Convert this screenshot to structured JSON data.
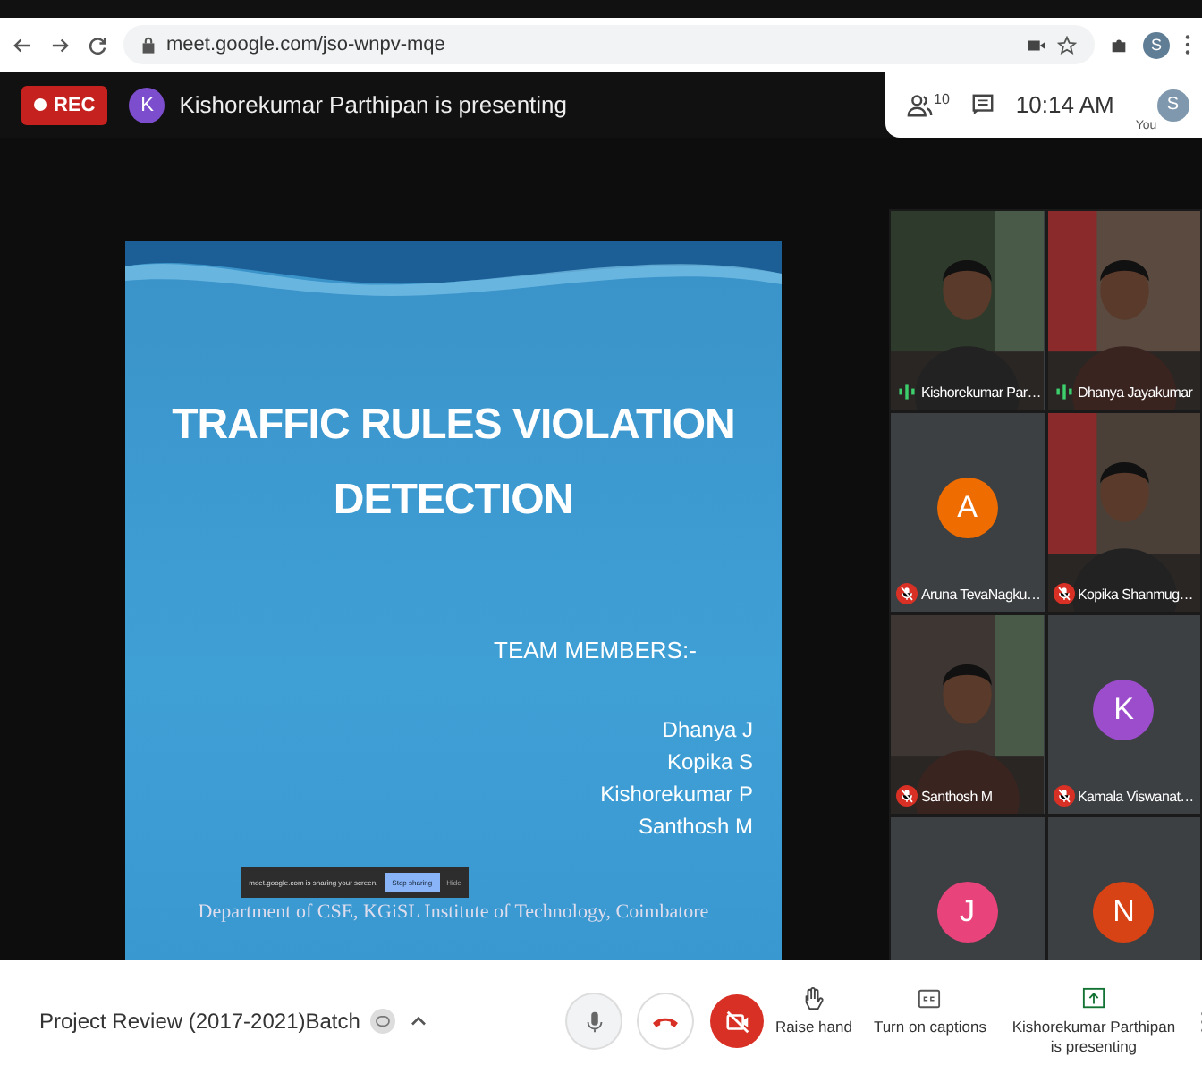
{
  "browser": {
    "url": "meet.google.com/jso-wnpv-mqe",
    "profile_initial": "S"
  },
  "header": {
    "rec_label": "REC",
    "presenter_initial": "K",
    "presenter_text": "Kishorekumar Parthipan is presenting",
    "participant_count": "10",
    "time": "10:14 AM",
    "you_label": "You",
    "you_initial": "S"
  },
  "slide": {
    "title_lines": [
      "TRAFFIC RULES VIOLATION",
      "DETECTION"
    ],
    "team_heading": "TEAM MEMBERS:-",
    "members": [
      "Dhanya J",
      "Kopika S",
      "Kishorekumar P",
      "Santhosh M"
    ],
    "share_bar": {
      "message": "meet.google.com is sharing your screen.",
      "stop": "Stop sharing",
      "hide": "Hide"
    },
    "footer": "Department of CSE, KGiSL Institute of Technology, Coimbatore"
  },
  "tiles": [
    {
      "kind": "picture",
      "name": "Kishorekumar Par…",
      "muted": false
    },
    {
      "kind": "picture",
      "name": "Dhanya Jayakumar",
      "muted": false
    },
    {
      "kind": "avatar",
      "initial": "A",
      "color": "#ef6c00",
      "name": "Aruna TevaNagku…",
      "muted": true
    },
    {
      "kind": "picture",
      "name": "Kopika Shanmug…",
      "muted": true
    },
    {
      "kind": "picture",
      "name": "Santhosh M",
      "muted": true
    },
    {
      "kind": "avatar",
      "initial": "K",
      "color": "#9c4dcc",
      "name": "Kamala Viswanat…",
      "muted": true
    },
    {
      "kind": "avatar",
      "initial": "J",
      "color": "#e8437a"
    },
    {
      "kind": "avatar",
      "initial": "N",
      "color": "#d84315"
    }
  ],
  "toolbar": {
    "meeting_name": "Project Review (2017-2021)Batch",
    "mic_on": true,
    "camera_on": false,
    "actions": [
      {
        "kind": "hand",
        "label": "Raise hand"
      },
      {
        "kind": "captions",
        "label": "Turn on captions"
      },
      {
        "kind": "present",
        "label": "Kishorekumar Parthipan is presenting"
      }
    ]
  }
}
